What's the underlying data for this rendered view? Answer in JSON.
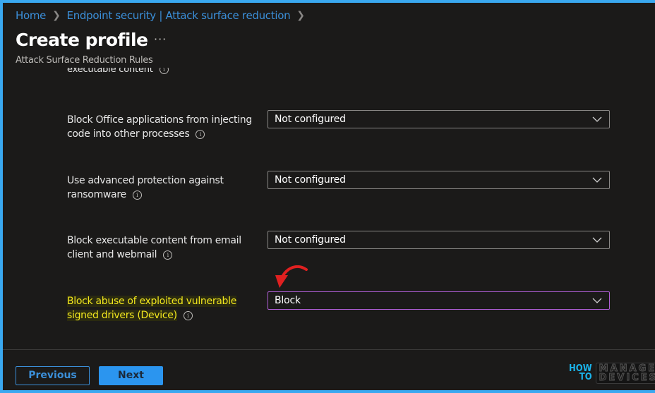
{
  "breadcrumb": [
    {
      "label": "Home"
    },
    {
      "label": "Endpoint security | Attack surface reduction"
    }
  ],
  "header": {
    "title": "Create profile",
    "more_label": "···",
    "subtitle": "Attack Surface Reduction Rules"
  },
  "clipped_row": {
    "label": "executable content"
  },
  "settings": [
    {
      "label": "Block Office applications from injecting code into other processes",
      "value": "Not configured"
    },
    {
      "label": "Use advanced protection against ransomware",
      "value": "Not configured"
    },
    {
      "label": "Block executable content from email client and webmail",
      "value": "Not configured"
    },
    {
      "label": "Block abuse of exploited vulnerable signed drivers (Device)",
      "value": "Block",
      "highlighted": true
    }
  ],
  "footer": {
    "previous_label": "Previous",
    "next_label": "Next"
  },
  "watermark": {
    "how": "HOW",
    "to": "TO",
    "manage": "MANAGE",
    "devices": "DEVICES"
  },
  "colors": {
    "accent": "#2b95ef",
    "link": "#3b8fd9",
    "highlight_text": "#f2e71e",
    "active_border": "#b05fd6",
    "annotation_arrow": "#e02020"
  }
}
